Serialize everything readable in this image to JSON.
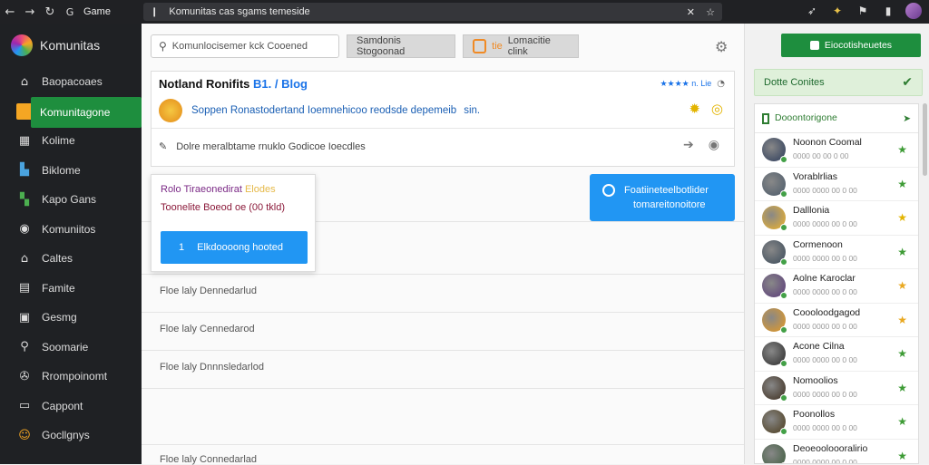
{
  "browser": {
    "tab_title": "Game",
    "url": "Komunitas cas sgams temeside",
    "back_icon": "arrow-left",
    "forward_icon": "arrow-right",
    "reload_icon": "reload",
    "lock_icon": "lock"
  },
  "sidebar": {
    "brand": "Komunitas",
    "items": [
      {
        "label": "Baopacoaes",
        "icon": "home-icon"
      },
      {
        "label": "Komunitagone",
        "icon": "community-icon"
      },
      {
        "label": "Kolime",
        "icon": "grid-icon"
      },
      {
        "label": "Biklome",
        "icon": "bookmark-icon"
      },
      {
        "label": "Kapo Gans",
        "icon": "store-icon"
      },
      {
        "label": "Komuniitos",
        "icon": "people-icon"
      },
      {
        "label": "Caltes",
        "icon": "home2-icon"
      },
      {
        "label": "Famite",
        "icon": "doc-icon"
      },
      {
        "label": "Gesmg",
        "icon": "gamepad-icon"
      },
      {
        "label": "Soomarie",
        "icon": "search-icon"
      },
      {
        "label": "Rrompoinomt",
        "icon": "settings-icon"
      },
      {
        "label": "Cappont",
        "icon": "chat-icon"
      },
      {
        "label": "Gocllgnys",
        "icon": "smile-icon"
      }
    ]
  },
  "topbar": {
    "search_placeholder": "Komunlocisemer kck Cooened",
    "btn_left": "Samdonis Stogoonad",
    "btn_right_badge": "tie",
    "btn_right": "Lomacitie clink"
  },
  "post_card": {
    "title_main": "Notland Ronifits",
    "title_accent": "B1. / Blog",
    "stars_text": "★★★★ n. Lie",
    "post_text": "Soppen Ronastodertand Ioemnehicoo reodsde depemeib",
    "post_end": "sin.",
    "share_text": "Dolre meralbtame rnuklo Godicoe Ioecdles"
  },
  "popup": {
    "title_dark": "Rolo Tiraeonedirat",
    "title_light": "Elodes",
    "subtitle": "Toonelite Boeod oe (00 tkld)",
    "button_num": "1",
    "button_label": "Elkdoooong hooted"
  },
  "blue_button": {
    "line1": "Foatiineteelbotlider",
    "line2": "tomareitonoitore"
  },
  "feed_rows": [
    "Floe laly Dennedarlud",
    "Floe laly Cennedarod",
    "Floe laly Dnnnsledarlod",
    "Floe laly Connedarlad"
  ],
  "right": {
    "green_btn": "Eiocotisheuetes",
    "online_label": "Dotte Conites",
    "friends_header": "Dooontorigone",
    "friends": [
      {
        "name": "Noonon Coomal",
        "sub": "0000 00 00 0 00",
        "star_color": "#3d9b35",
        "av": "#2a3a5a"
      },
      {
        "name": "Vorablrlias",
        "sub": "0000 0000 00 0 00",
        "star_color": "#3d9b35",
        "av": "#4a5a6a"
      },
      {
        "name": "Dalllonia",
        "sub": "0000 0000 00 0 00",
        "star_color": "#e3b400",
        "av": "#f0b429"
      },
      {
        "name": "Cormenoon",
        "sub": "0000 0000 00 0 00",
        "star_color": "#3d9b35",
        "av": "#3a4a5a"
      },
      {
        "name": "Aolne Karoclar",
        "sub": "0000 0000 00 0 00",
        "star_color": "#e9a820",
        "av": "#5a3a7a"
      },
      {
        "name": "Coooloodgagod",
        "sub": "0000 0000 00 0 00",
        "star_color": "#e9a820",
        "av": "#e89a20"
      },
      {
        "name": "Acone Cilna",
        "sub": "0000 0000 00 0 00",
        "star_color": "#3d9b35",
        "av": "#2a2a2a"
      },
      {
        "name": "Nomoolios",
        "sub": "0000 0000 00 0 00",
        "star_color": "#3d9b35",
        "av": "#3a2a1a"
      },
      {
        "name": "Poonollos",
        "sub": "0000 0000 00 0 00",
        "star_color": "#3d9b35",
        "av": "#4a3a1a"
      },
      {
        "name": "Deoeooloooralirio",
        "sub": "0000 0000 00 0 00",
        "star_color": "#3d9b35",
        "av": "#3a5a3a"
      }
    ]
  },
  "colors": {
    "accent_green": "#1e8e3e",
    "accent_blue": "#2196f3",
    "sidebar_bg": "#1f2124"
  }
}
